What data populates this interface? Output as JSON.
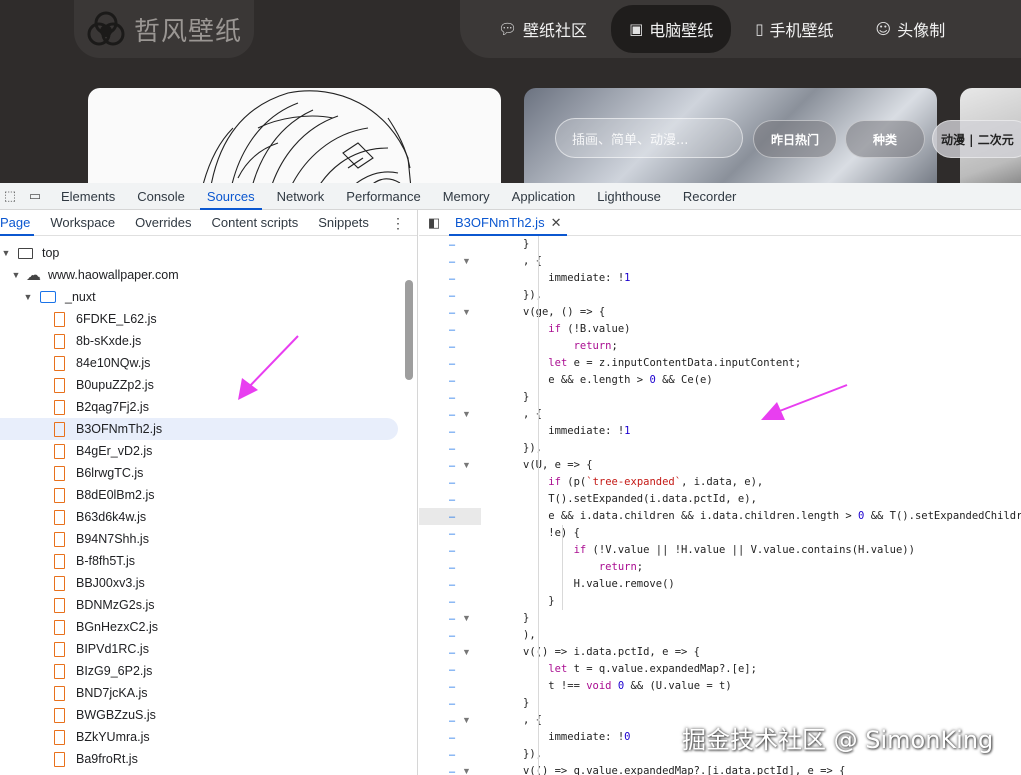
{
  "site": {
    "logo_text": "哲风壁纸",
    "nav": [
      {
        "label": "壁纸社区",
        "icon": "chat-icon"
      },
      {
        "label": "电脑壁纸",
        "icon": "image-icon"
      },
      {
        "label": "手机壁纸",
        "icon": "phone-icon"
      },
      {
        "label": "头像制",
        "icon": "smile-icon"
      }
    ],
    "active_nav": 1,
    "search_placeholder": "插画、简单、动漫...",
    "pills": {
      "hot": "昨日热门",
      "type": "种类",
      "anime": "动漫 | 二次元"
    }
  },
  "devtools": {
    "tabs": [
      "Elements",
      "Console",
      "Sources",
      "Network",
      "Performance",
      "Memory",
      "Application",
      "Lighthouse",
      "Recorder"
    ],
    "active_tab": "Sources",
    "subtabs": [
      "Page",
      "Workspace",
      "Overrides",
      "Content scripts",
      "Snippets"
    ],
    "tree": {
      "top": "top",
      "domain": "www.haowallpaper.com",
      "folder": "_nuxt",
      "files": [
        "6FDKE_L62.js",
        "8b-sKxde.js",
        "84e10NQw.js",
        "B0upuZZp2.js",
        "B2qag7Fj2.js",
        "B3OFNmTh2.js",
        "B4gEr_vD2.js",
        "B6lrwgTC.js",
        "B8dE0lBm2.js",
        "B63d6k4w.js",
        "B94N7Shh.js",
        "B-f8fh5T.js",
        "BBJ00xv3.js",
        "BDNMzG2s.js",
        "BGnHezxC2.js",
        "BIPVd1RC.js",
        "BIzG9_6P2.js",
        "BND7jcKA.js",
        "BWGBZzuS.js",
        "BZkYUmra.js",
        "Ba9froRt.js"
      ],
      "selected_index": 5
    },
    "open_file": "B3OFNmTh2.js",
    "code_lines": [
      "}",
      ", {",
      "    immediate: !1",
      "}),",
      "v(ge, () => {",
      "    if (!B.value)",
      "        return;",
      "    let e = z.inputContentData.inputContent;",
      "    e && e.length > 0 && Ce(e)",
      "}",
      ", {",
      "    immediate: !1",
      "}),",
      "v(U, e => {",
      "    if (p(`tree-expanded`, i.data, e),",
      "    T().setExpanded(i.data.pctId, e),",
      "    e && i.data.children && i.data.children.length > 0 && T().setExpandedChildren(i",
      "    !e) {",
      "        if (!V.value || !H.value || V.value.contains(H.value))",
      "            return;",
      "        H.value.remove()",
      "    }",
      "}",
      "),",
      "v(() => i.data.pctId, e => {",
      "    let t = q.value.expandedMap?.[e];",
      "    t !== void 0 && (U.value = t)",
      "}",
      ", {",
      "    immediate: !0",
      "}),",
      "v(() => q.value.expandedMap?.[i.data.pctId], e => {"
    ]
  },
  "watermark": "掘金技术社区 @ SimonKing",
  "colors": {
    "accent": "#0b57d0",
    "file_icon": "#e8711c",
    "annotation_arrow": "#e83ef0"
  }
}
